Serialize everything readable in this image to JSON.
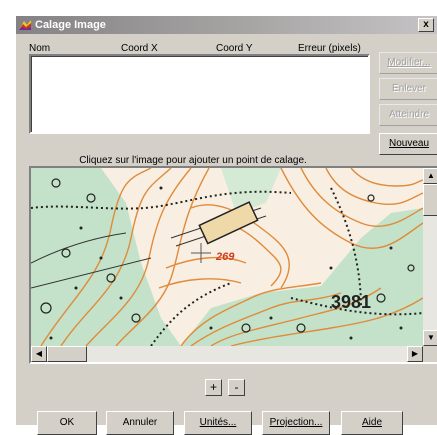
{
  "window": {
    "title": "Calage Image",
    "close_glyph": "x"
  },
  "columns": [
    "Nom",
    "Coord X",
    "Coord Y",
    "Erreur (pixels)"
  ],
  "side_buttons": {
    "modifier": {
      "label": "Modifier...",
      "enabled": false
    },
    "enlever": {
      "label": "Enlever",
      "enabled": false
    },
    "atteindre": {
      "label": "Atteindre",
      "enabled": false
    },
    "nouveau": {
      "label": "Nouveau",
      "enabled": true
    }
  },
  "hint": "Cliquez sur l'image pour ajouter un point de calage.",
  "map": {
    "label_elevation": "3981",
    "label_red": "269",
    "icons": {
      "scroll_up": "scroll-up-arrow-icon",
      "scroll_down": "scroll-down-arrow-icon",
      "scroll_left": "scroll-left-arrow-icon",
      "scroll_right": "scroll-right-arrow-icon"
    }
  },
  "zoom": {
    "in": "+",
    "out": "-"
  },
  "bottom_buttons": {
    "ok": "OK",
    "annuler": "Annuler",
    "unites": "Unités...",
    "projection": "Projection...",
    "aide": "Aide"
  },
  "colors": {
    "dialog_bg": "#d4d0c8",
    "titlebar_start": "#848284",
    "titlebar_end": "#c6c3c6",
    "map_contour": "#e08a3a",
    "map_forest": "#bfe0c6"
  }
}
